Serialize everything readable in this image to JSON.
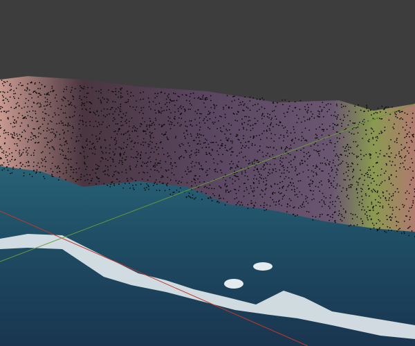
{
  "viewport": {
    "background_color": "#3d3d3d",
    "ocean_color": "#1e4a5e",
    "cliff_color": "#6e5a70",
    "foam_color": "#e6eef0",
    "x_axis_color": "#c0392b",
    "y_axis_color": "#6a9a3a",
    "vertex_color": "#0a0a0a"
  }
}
